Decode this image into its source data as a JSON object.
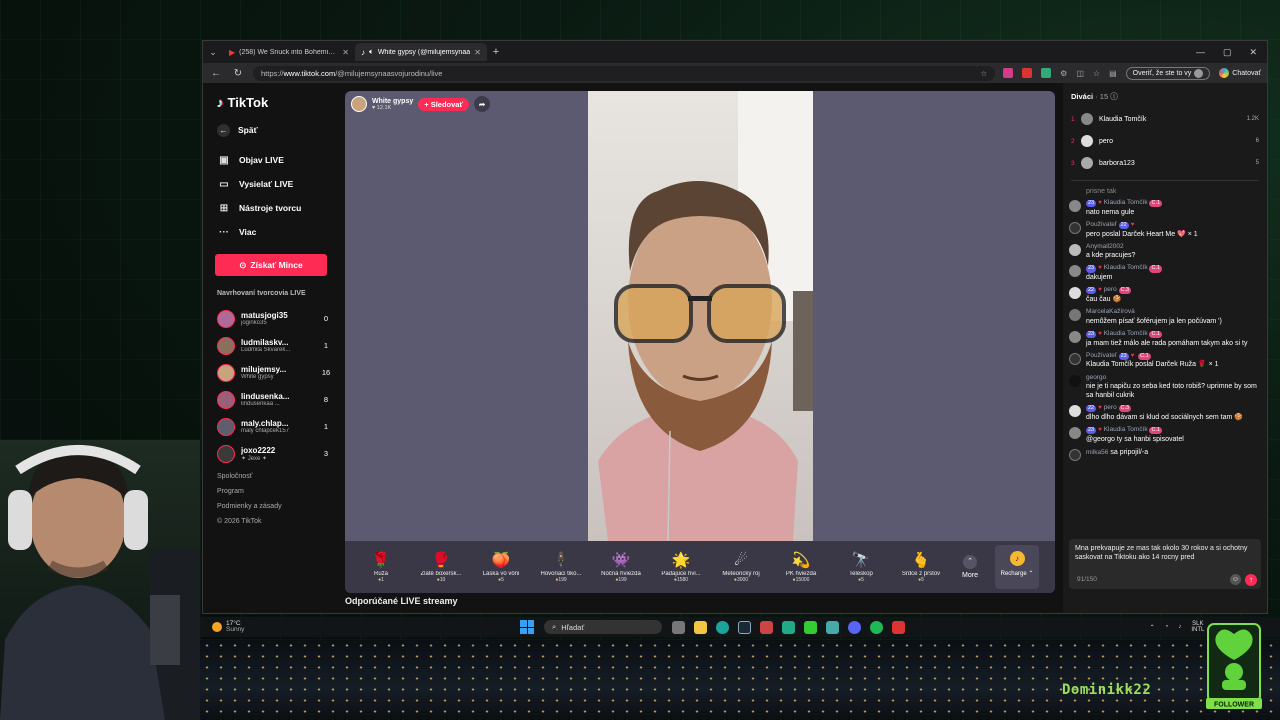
{
  "browser": {
    "tabs": [
      {
        "title": "(258) We Snuck into Bohemian G",
        "active": false
      },
      {
        "title": "White gypsy (@milujemsynaa",
        "active": true
      }
    ],
    "url_prefix": "https://",
    "url_host": "www.tiktok.com",
    "url_path": "/@milujemsynaasvojurodinu/live",
    "verify_label": "Overiť, že ste to vy",
    "chat_label": "Chatovať"
  },
  "sidebar": {
    "logo": "TikTok",
    "back": "Späť",
    "nav": [
      {
        "label": "Objav LIVE",
        "icon": "▣"
      },
      {
        "label": "Vysielať LIVE",
        "icon": "▭"
      },
      {
        "label": "Nástroje tvorcu",
        "icon": "⊞"
      },
      {
        "label": "Viac",
        "icon": "···"
      }
    ],
    "coins_button": "Získať Mince",
    "suggested_title": "Navrhovaní tvorcovia LIVE",
    "creators": [
      {
        "name": "matusjogi35",
        "sub": "joginko35",
        "count": "0",
        "color": "#b06a9a"
      },
      {
        "name": "ludmilaskv...",
        "sub": "Ľudmila Škvarek...",
        "count": "1",
        "color": "#8a6f5c"
      },
      {
        "name": "milujemsy...",
        "sub": "White gypsy",
        "count": "16",
        "color": "#c9a27e"
      },
      {
        "name": "lindusenka...",
        "sub": "lindusenkaa ...",
        "count": "8",
        "color": "#9a5f7a"
      },
      {
        "name": "maly.chlap...",
        "sub": "maly chlapček157",
        "count": "1",
        "color": "#5e5e6e"
      },
      {
        "name": "joxo2222",
        "sub": "✦ Jexe ✦",
        "count": "3",
        "color": "#3a3a3a"
      }
    ],
    "footer": [
      "Spoločnosť",
      "Program",
      "Podmienky a zásady",
      "© 2026 TikTok"
    ]
  },
  "live": {
    "host_name": "White gypsy",
    "host_likes": "♥ 12.1K",
    "follow_label": "+ Sledovať",
    "gifts": [
      {
        "name": "Ruža",
        "price": "1",
        "icon": "🌹"
      },
      {
        "name": "Zlaté boxersk...",
        "price": "10",
        "icon": "🥊"
      },
      {
        "name": "Láska vo vôni",
        "price": "5",
        "icon": "🍑"
      },
      {
        "name": "Hovoriaci tiko...",
        "price": "199",
        "icon": "🕴"
      },
      {
        "name": "Nočná hviezda",
        "price": "199",
        "icon": "👾"
      },
      {
        "name": "Padajúce hvi...",
        "price": "1580",
        "icon": "🌟"
      },
      {
        "name": "Meteorický roj",
        "price": "3000",
        "icon": "☄"
      },
      {
        "name": "PK hviezda",
        "price": "15000",
        "icon": "💫"
      },
      {
        "name": "Teleskop",
        "price": "5",
        "icon": "🔭"
      },
      {
        "name": "Srdce z prstov",
        "price": "5",
        "icon": "🫰"
      }
    ],
    "more_label": "More",
    "recharge_label": "Recharge ⌃",
    "recommended": "Odporúčané LIVE streamy"
  },
  "chat": {
    "viewers_title": "Diváci",
    "viewers_count": "· 15",
    "top_viewers": [
      {
        "rank": "1",
        "name": "Klaudia Tomčík",
        "count": "1.2K"
      },
      {
        "rank": "2",
        "name": "pero",
        "count": "6"
      },
      {
        "rank": "3",
        "name": "barbora123",
        "count": "5"
      }
    ],
    "partial_line": "prisne tak",
    "messages": [
      {
        "user": "Klaudia Tomčík",
        "lvl": "23",
        "fan": "C.1",
        "text": "nato nema gule"
      },
      {
        "user": "Používateľ",
        "lvl": "22",
        "fan": "",
        "text": "pero poslal Darček Heart Me 💖 × 1"
      },
      {
        "user": "Anymall2002",
        "lvl": "",
        "fan": "",
        "text": "a kde pracujes?"
      },
      {
        "user": "Klaudia Tomčík",
        "lvl": "23",
        "fan": "C.1",
        "text": "dakujem"
      },
      {
        "user": "pero",
        "lvl": "22",
        "fan": "C.3",
        "text": "čau čau 🍪"
      },
      {
        "user": "MarcelaKažírová",
        "lvl": "",
        "fan": "",
        "text": "nemôžem písať šoférujem ja len počúvam ')"
      },
      {
        "user": "Klaudia Tomčík",
        "lvl": "23",
        "fan": "C.1",
        "text": "ja mam tiež málo ale rada pomáham takym ako si ty"
      },
      {
        "user": "Používateľ",
        "lvl": "23",
        "fan": "C.1",
        "text": "Klaudia Tomčík poslal Darček Ruža 🌹 × 1"
      },
      {
        "user": "georgo",
        "lvl": "",
        "fan": "",
        "text": "nie je ti napiču zo seba ked toto robiš? uprimne by som sa hanbil cukrik"
      },
      {
        "user": "pero",
        "lvl": "22",
        "fan": "C.3",
        "text": "dlho dlho dávam si klud od sociálnych sem tam 🍪"
      },
      {
        "user": "Klaudia Tomčík",
        "lvl": "23",
        "fan": "C.1",
        "text": "@georgo ty sa hanbi spisovatel"
      },
      {
        "user": "milka56",
        "lvl": "",
        "fan": "",
        "text": "sa pripojil/-a"
      }
    ],
    "draft": "Mna prekvapuje ze mas tak okolo 30 rokov a si ochotny saskovat na Tiktoku ako 14 rocny pred",
    "char_counter": "91/150"
  },
  "taskbar": {
    "temp": "17°C",
    "weather": "Sunny",
    "search": "Hľadať",
    "lang_top": "SLK",
    "lang_bottom": "INTL"
  },
  "overlay": {
    "channel_name": "Dominikk22",
    "follower_label": "FOLLOWER"
  }
}
